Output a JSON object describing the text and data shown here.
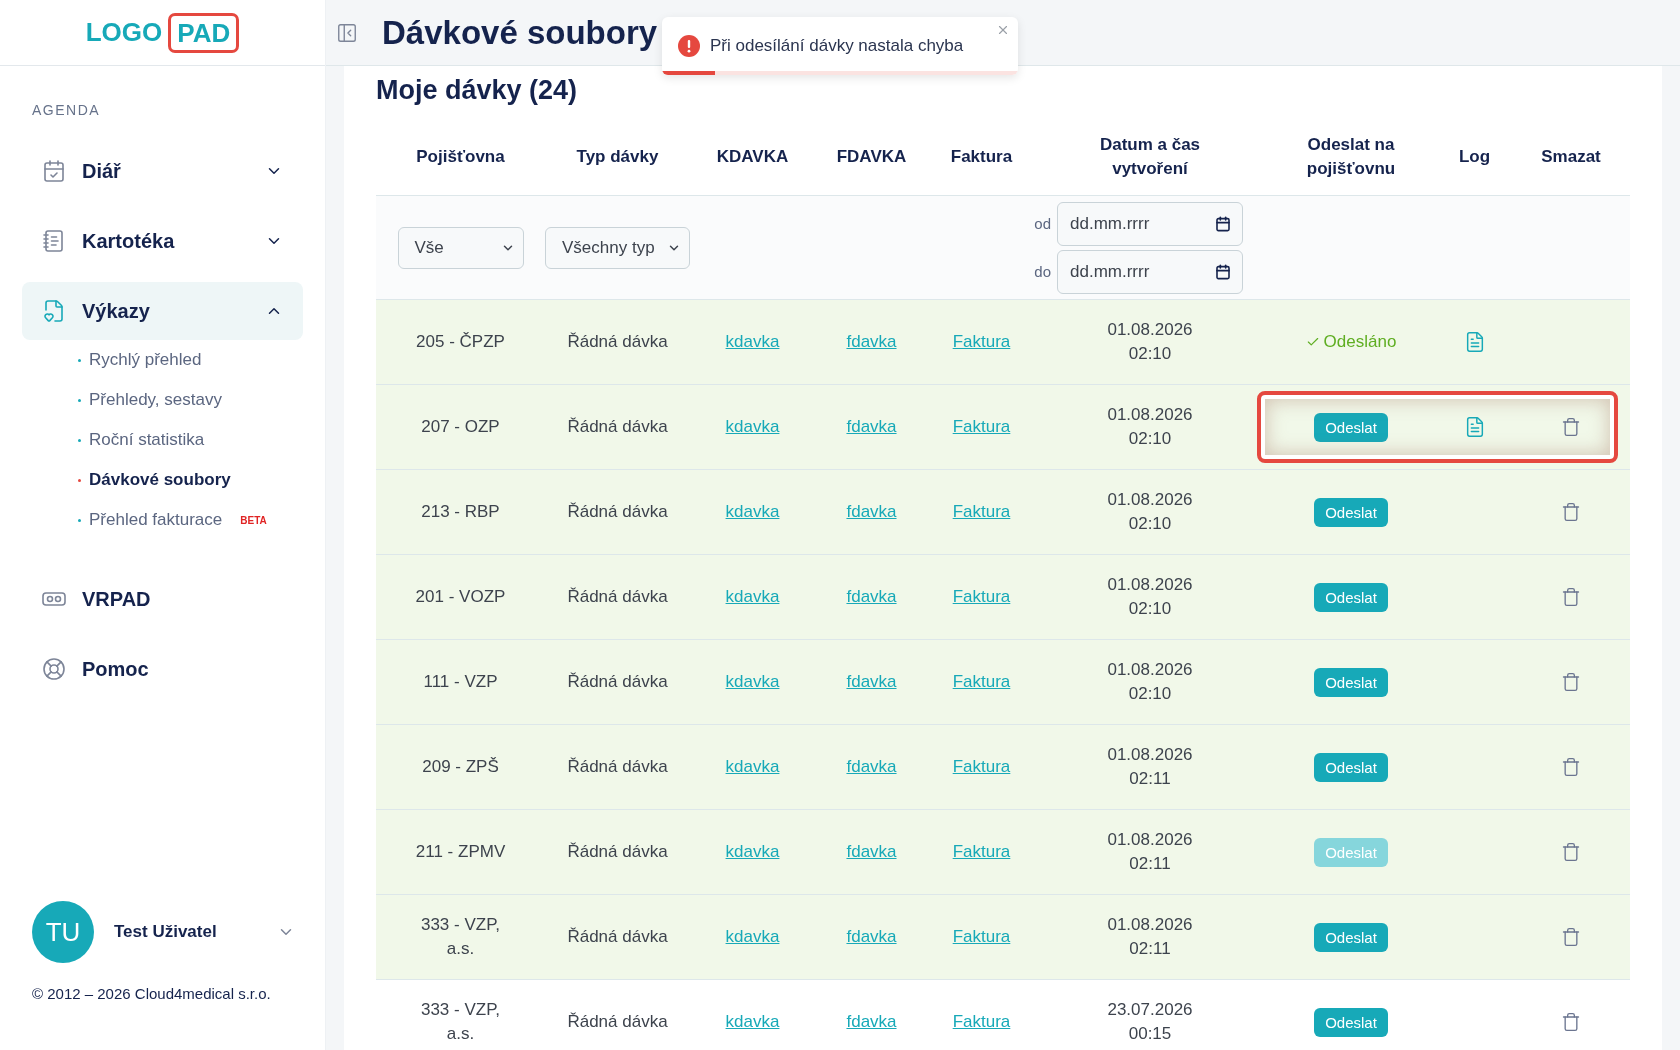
{
  "logo": {
    "part_1": "LOGO",
    "part_2": "PAD"
  },
  "sidebar": {
    "section": "AGENDA",
    "items": [
      {
        "label": "Diář",
        "expanded": false,
        "selected": false
      },
      {
        "label": "Kartotéka",
        "expanded": false,
        "selected": false
      },
      {
        "label": "Výkazy",
        "expanded": true,
        "selected": true,
        "children": [
          {
            "label": "Rychlý přehled",
            "selected": false
          },
          {
            "label": "Přehledy, sestavy",
            "selected": false
          },
          {
            "label": "Roční statistika",
            "selected": false
          },
          {
            "label": "Dávkové soubory",
            "selected": true
          },
          {
            "label": "Přehled fakturace",
            "selected": false,
            "badge": "BETA"
          }
        ]
      },
      {
        "label": "VRPAD",
        "selected": false
      },
      {
        "label": "Pomoc",
        "selected": false
      }
    ],
    "user": {
      "initials": "TU",
      "name": "Test Uživatel"
    },
    "footer": "© 2012 – 2026 Cloud4medical s.r.o."
  },
  "page_title": "Dávkové soubory",
  "toast": {
    "message": "Při odesílání dávky nastala chyba",
    "level": 0.15
  },
  "section_title": "Moje dávky (24)",
  "table": {
    "columns": [
      "Pojišťovna",
      "Typ dávky",
      "KDAVKA",
      "FDAVKA",
      "Faktura",
      "Datum a čas vytvoření",
      "Odeslat na pojišťovnu",
      "Log",
      "Smazat"
    ],
    "filters": {
      "insurer": "Vše",
      "type": "Všechny typ",
      "from_label": "od",
      "from_placeholder": "dd.mm.rrrr",
      "to_label": "do",
      "to_placeholder": "dd.mm.rrrr"
    },
    "rows": [
      {
        "insurer": "205 - ČPZP",
        "type": "Řádná dávka",
        "kdavka": "kdavka",
        "fdavka": "fdavka",
        "invoice": "Faktura",
        "date": "01.08.2026",
        "time": "02:10",
        "send": {
          "kind": "status",
          "label": "Odesláno"
        },
        "log": true,
        "delete": false,
        "shaded": true,
        "highlighted": false
      },
      {
        "insurer": "207 - OZP",
        "type": "Řádná dávka",
        "kdavka": "kdavka",
        "fdavka": "fdavka",
        "invoice": "Faktura",
        "date": "01.08.2026",
        "time": "02:10",
        "send": {
          "kind": "button",
          "label": "Odeslat",
          "disabled": false
        },
        "log": true,
        "delete": true,
        "shaded": true,
        "highlighted": true
      },
      {
        "insurer": "213 - RBP",
        "type": "Řádná dávka",
        "kdavka": "kdavka",
        "fdavka": "fdavka",
        "invoice": "Faktura",
        "date": "01.08.2026",
        "time": "02:10",
        "send": {
          "kind": "button",
          "label": "Odeslat",
          "disabled": false
        },
        "log": false,
        "delete": true,
        "shaded": true,
        "highlighted": false
      },
      {
        "insurer": "201 - VOZP",
        "type": "Řádná dávka",
        "kdavka": "kdavka",
        "fdavka": "fdavka",
        "invoice": "Faktura",
        "date": "01.08.2026",
        "time": "02:10",
        "send": {
          "kind": "button",
          "label": "Odeslat",
          "disabled": false
        },
        "log": false,
        "delete": true,
        "shaded": true,
        "highlighted": false
      },
      {
        "insurer": "111 - VZP",
        "type": "Řádná dávka",
        "kdavka": "kdavka",
        "fdavka": "fdavka",
        "invoice": "Faktura",
        "date": "01.08.2026",
        "time": "02:10",
        "send": {
          "kind": "button",
          "label": "Odeslat",
          "disabled": false
        },
        "log": false,
        "delete": true,
        "shaded": true,
        "highlighted": false
      },
      {
        "insurer": "209 - ZPŠ",
        "type": "Řádná dávka",
        "kdavka": "kdavka",
        "fdavka": "fdavka",
        "invoice": "Faktura",
        "date": "01.08.2026",
        "time": "02:11",
        "send": {
          "kind": "button",
          "label": "Odeslat",
          "disabled": false
        },
        "log": false,
        "delete": true,
        "shaded": true,
        "highlighted": false
      },
      {
        "insurer": "211 - ZPMV",
        "type": "Řádná dávka",
        "kdavka": "kdavka",
        "fdavka": "fdavka",
        "invoice": "Faktura",
        "date": "01.08.2026",
        "time": "02:11",
        "send": {
          "kind": "button",
          "label": "Odeslat",
          "disabled": true
        },
        "log": false,
        "delete": true,
        "shaded": true,
        "highlighted": false
      },
      {
        "insurer": "333 - VZP, a.s.",
        "type": "Řádná dávka",
        "kdavka": "kdavka",
        "fdavka": "fdavka",
        "invoice": "Faktura",
        "date": "01.08.2026",
        "time": "02:11",
        "send": {
          "kind": "button",
          "label": "Odeslat",
          "disabled": false
        },
        "log": false,
        "delete": true,
        "shaded": true,
        "highlighted": false
      },
      {
        "insurer": "333 - VZP, a.s.",
        "type": "Řádná dávka",
        "kdavka": "kdavka",
        "fdavka": "fdavka",
        "invoice": "Faktura",
        "date": "23.07.2026",
        "time": "00:15",
        "send": {
          "kind": "button",
          "label": "Odeslat",
          "disabled": false
        },
        "log": false,
        "delete": true,
        "shaded": false,
        "highlighted": false
      }
    ]
  }
}
